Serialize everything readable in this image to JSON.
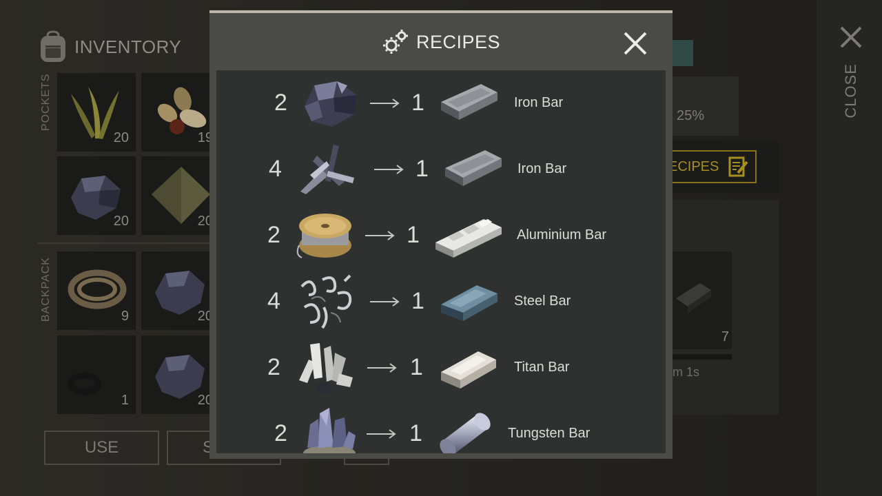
{
  "background": {
    "inventory_title": "INVENTORY",
    "pockets_label": "POCKETS",
    "backpack_label": "BACKPACK",
    "pocket_slots": [
      {
        "icon": "plant-fiber-icon",
        "count": "20"
      },
      {
        "icon": "seeds-icon",
        "count": "19"
      },
      {
        "icon": "iron-ore-icon",
        "count": "20"
      },
      {
        "icon": "cloth-icon",
        "count": "20"
      }
    ],
    "backpack_slots": [
      {
        "icon": "rope-icon",
        "count": "9"
      },
      {
        "icon": "iron-ore-icon",
        "count": "20"
      },
      {
        "icon": "rubber-rings-icon",
        "count": "1"
      },
      {
        "icon": "iron-ore-icon",
        "count": "20"
      }
    ],
    "use_button": "USE",
    "second_button": "S",
    "stat_text": "25%",
    "recipes_button": "ECIPES",
    "furnace_slot_count": "7",
    "timer_text": "m 1s",
    "close_label": "CLOSE"
  },
  "modal": {
    "title": "RECIPES",
    "recipes": [
      {
        "input_qty": "2",
        "input_icon": "iron-ore-icon",
        "output_qty": "1",
        "output_icon": "iron-bar-icon",
        "output_name": "Iron Bar"
      },
      {
        "input_qty": "4",
        "input_icon": "scrap-metal-icon",
        "output_qty": "1",
        "output_icon": "iron-bar-icon",
        "output_name": "Iron Bar"
      },
      {
        "input_qty": "2",
        "input_icon": "wire-spool-icon",
        "output_qty": "1",
        "output_icon": "aluminium-bar-icon",
        "output_name": "Aluminium Bar"
      },
      {
        "input_qty": "4",
        "input_icon": "metal-shavings-icon",
        "output_qty": "1",
        "output_icon": "steel-bar-icon",
        "output_name": "Steel Bar"
      },
      {
        "input_qty": "2",
        "input_icon": "titan-ore-icon",
        "output_qty": "1",
        "output_icon": "titan-bar-icon",
        "output_name": "Titan Bar"
      },
      {
        "input_qty": "2",
        "input_icon": "tungsten-ore-icon",
        "output_qty": "1",
        "output_icon": "tungsten-bar-icon",
        "output_name": "Tungsten Bar"
      }
    ]
  },
  "colors": {
    "modal_bg": "#4a4b47",
    "list_bg": "#2f3130",
    "accent_gold": "#a8901f",
    "text": "#dcdcd6"
  }
}
